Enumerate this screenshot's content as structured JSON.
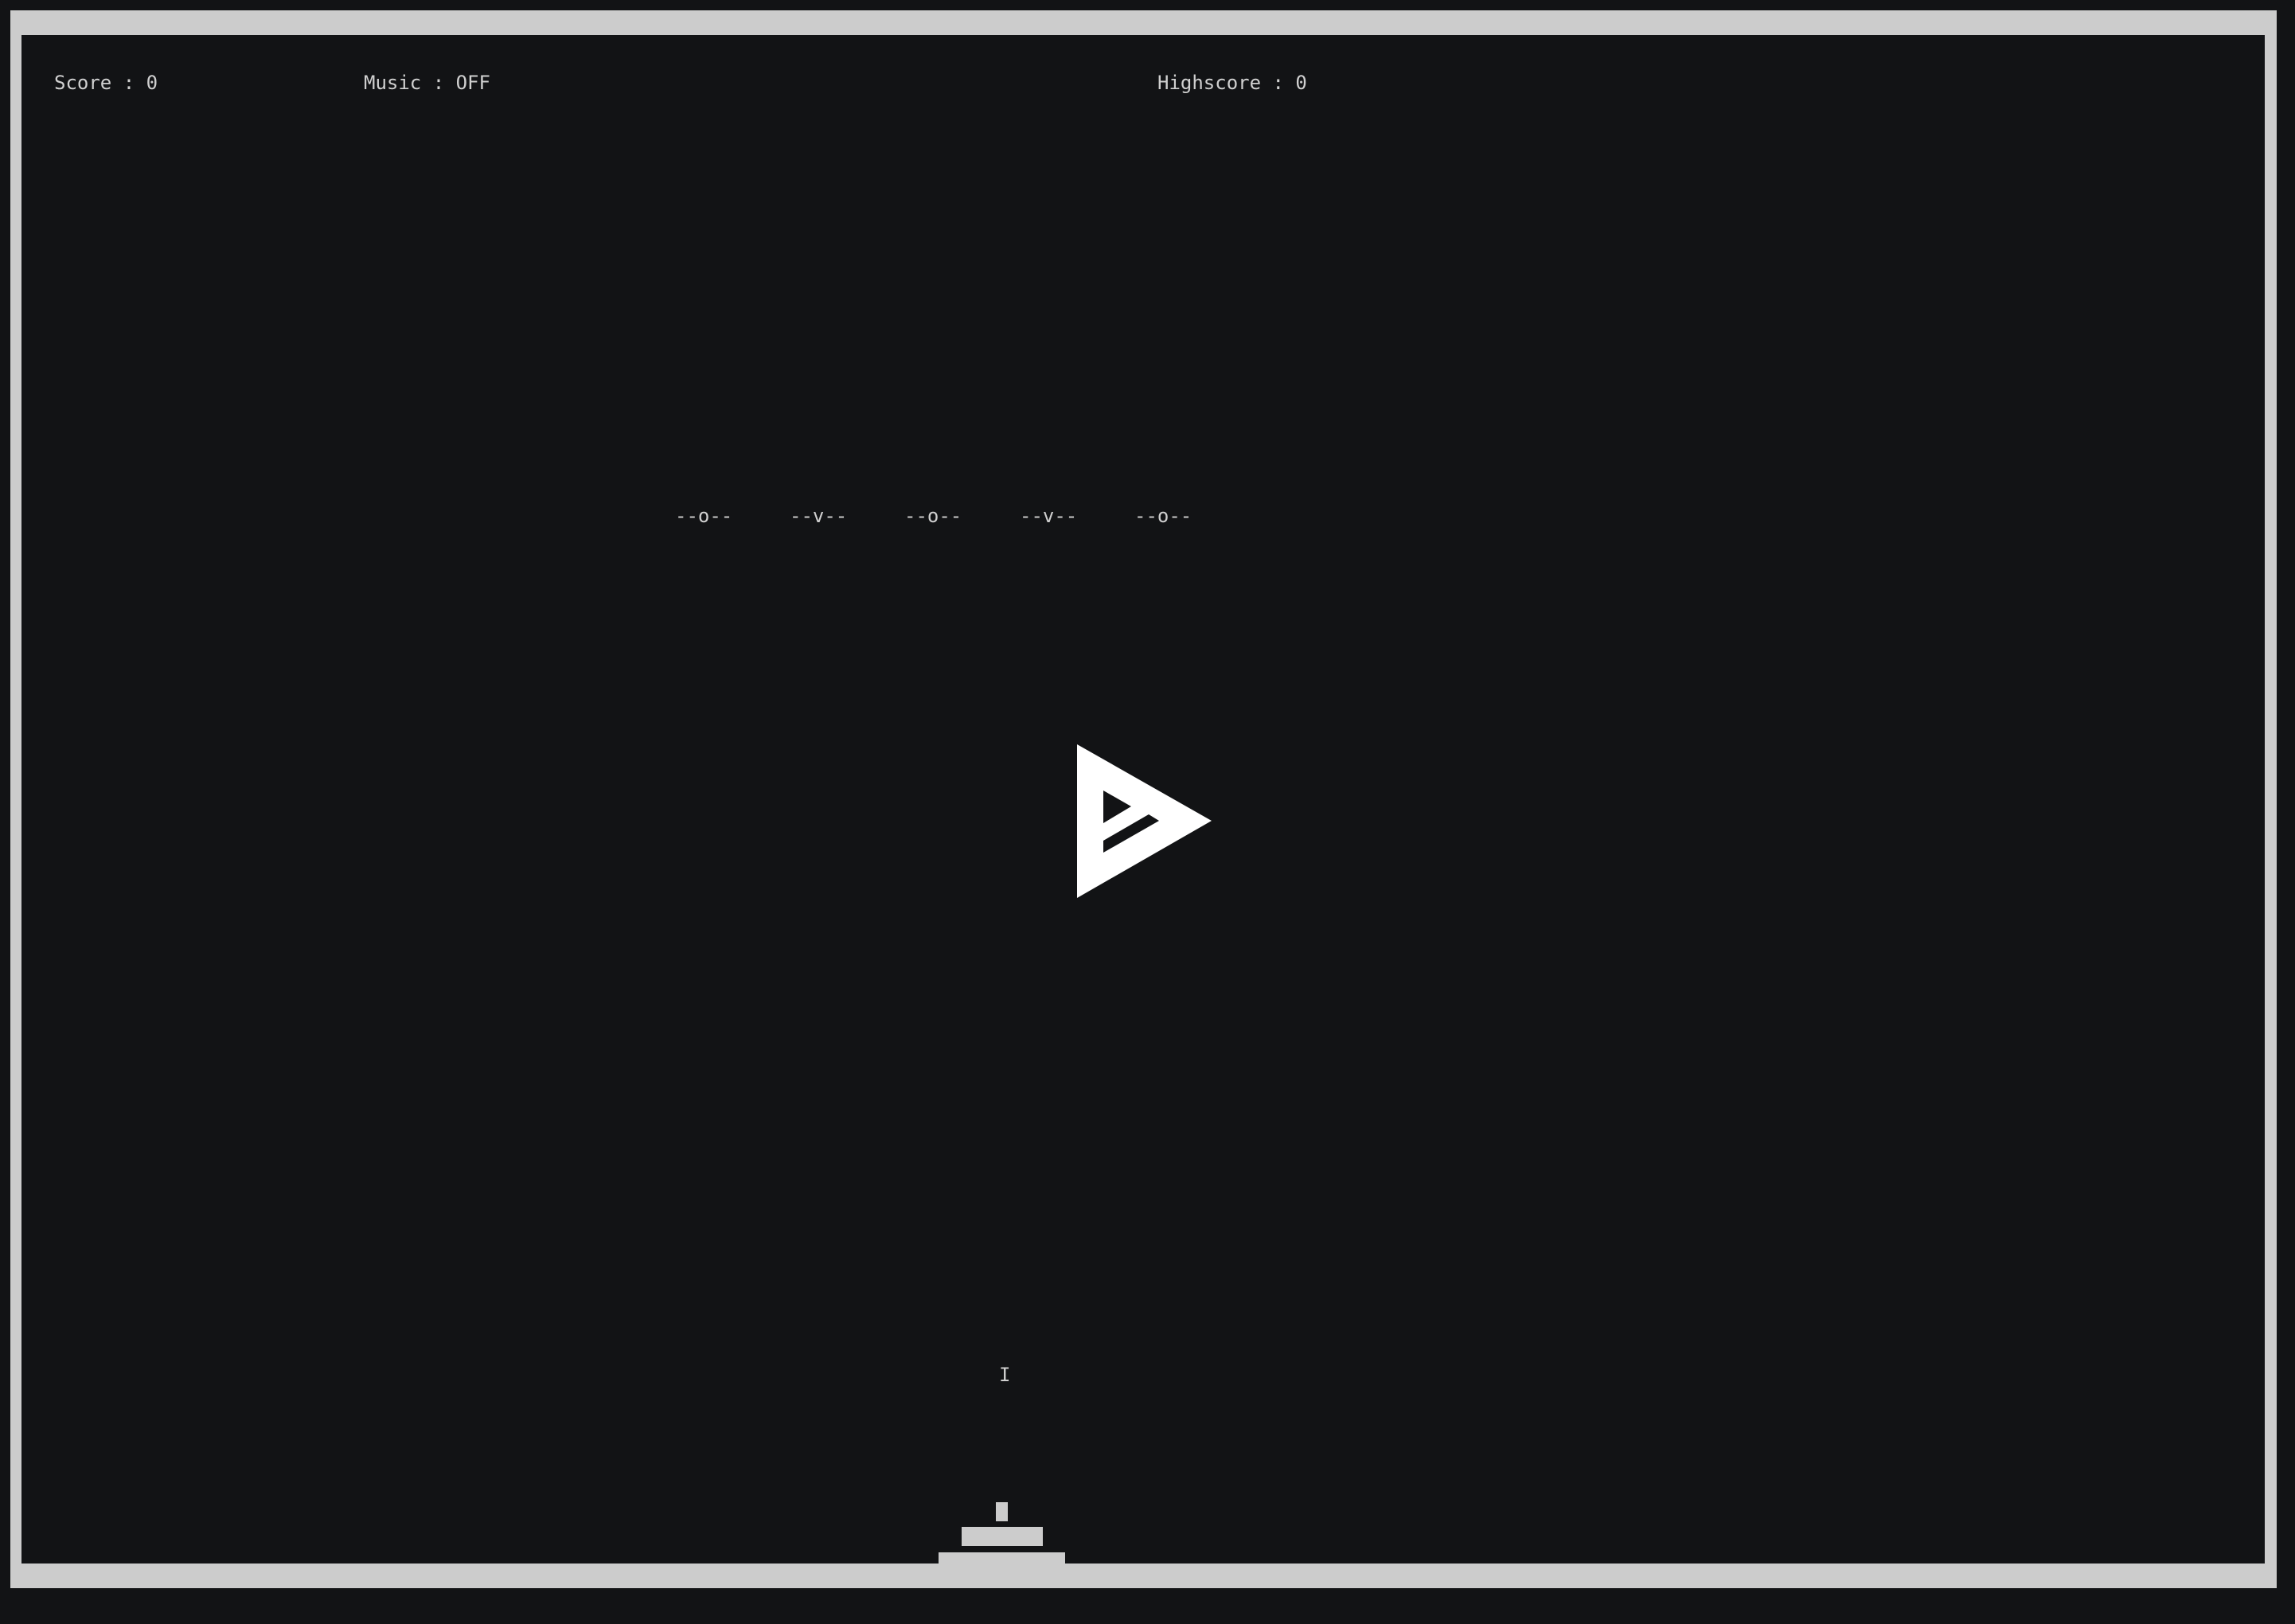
{
  "hud": {
    "score_text": "Score : 0",
    "music_text": "Music : OFF",
    "highscore_text": "Highscore : 0"
  },
  "enemies": [
    {
      "glyph": "--o--"
    },
    {
      "glyph": "--v--"
    },
    {
      "glyph": "--o--"
    },
    {
      "glyph": "--v--"
    },
    {
      "glyph": "--o--"
    }
  ],
  "player_bullet": {
    "glyph": "I"
  },
  "play_button": {
    "icon": "play-icon"
  },
  "colors": {
    "background": "#121315",
    "frame": "#cccccc",
    "text": "#d0d0d0",
    "play_icon": "#ffffff"
  }
}
